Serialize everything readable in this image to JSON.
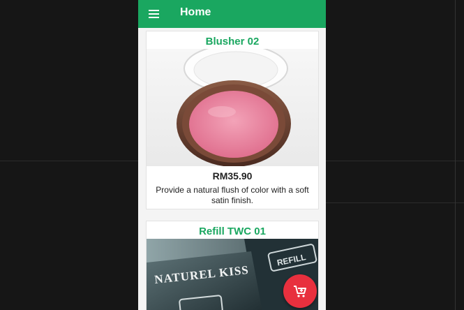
{
  "app": {
    "title": "Home"
  },
  "colors": {
    "appbar": "#1aa760",
    "title_green": "#1aa760",
    "fab": "#e8303e"
  },
  "products": [
    {
      "name": "Blusher 02",
      "price": "RM35.90",
      "description": "Provide a natural flush of color with a soft satin finish.",
      "image": "blusher-compact-photo"
    },
    {
      "name": "Refill TWC 01",
      "image": "refill-box-photo",
      "brand_text": "NATUREL KISS",
      "box_text": "REFILL"
    }
  ],
  "fab": {
    "icon": "add-to-cart-icon"
  },
  "menu": {
    "icon": "menu-icon"
  }
}
